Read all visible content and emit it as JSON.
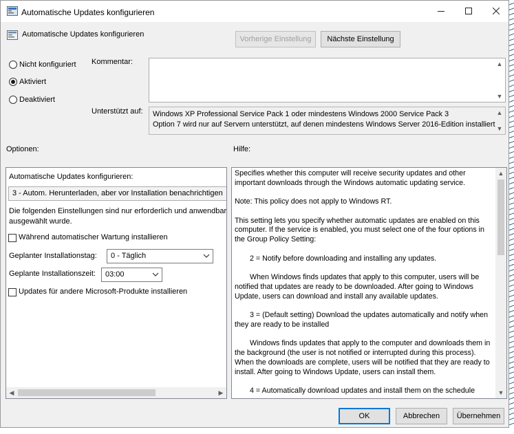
{
  "window": {
    "title": "Automatische Updates konfigurieren",
    "minimize": "—",
    "maximize": "☐",
    "close": "✕"
  },
  "header": {
    "title": "Automatische Updates konfigurieren",
    "prev_button": "Vorherige Einstellung",
    "next_button": "Nächste Einstellung"
  },
  "state": {
    "options": [
      "Nicht konfiguriert",
      "Aktiviert",
      "Deaktiviert"
    ],
    "selected": "Aktiviert"
  },
  "comment": {
    "label": "Kommentar:",
    "value": ""
  },
  "supported": {
    "label": "Unterstützt auf:",
    "line1": "Windows XP Professional Service Pack 1 oder mindestens Windows 2000 Service Pack 3",
    "line2": "Option 7 wird nur auf Servern unterstützt, auf denen mindestens Windows Server 2016-Edition installiert"
  },
  "sections": {
    "options_label": "Optionen:",
    "help_label": "Hilfe:"
  },
  "options_panel": {
    "configure_label": "Automatische Updates konfigurieren:",
    "configure_value": "3 - Autom. Herunterladen, aber vor Installation benachrichtigen",
    "info_line1": "Die folgenden Einstellungen sind nur erforderlich und anwendbar,",
    "info_line2": "ausgewählt wurde.",
    "maintenance_checkbox": "Während automatischer Wartung installieren",
    "day_label": "Geplanter Installationstag:",
    "day_value": "0 - Täglich",
    "time_label": "Geplante Installationszeit:",
    "time_value": "03:00",
    "other_products_checkbox": "Updates für andere Microsoft-Produkte installieren"
  },
  "help": {
    "paragraphs": [
      {
        "indent": false,
        "text": "Specifies whether this computer will receive security updates and other important downloads through the Windows automatic updating service."
      },
      {
        "indent": false,
        "text": "Note: This policy does not apply to Windows RT."
      },
      {
        "indent": false,
        "text": "This setting lets you specify whether automatic updates are enabled on this computer. If the service is enabled, you must select one of the four options in the Group Policy Setting:"
      },
      {
        "indent": true,
        "text": "2 = Notify before downloading and installing any updates."
      },
      {
        "indent": true,
        "text": "When Windows finds updates that apply to this computer, users will be notified that updates are ready to be downloaded. After going to Windows Update, users can download and install any available updates."
      },
      {
        "indent": true,
        "text": "3 = (Default setting) Download the updates automatically and notify when they are ready to be installed"
      },
      {
        "indent": true,
        "text": "Windows finds updates that apply to the computer and downloads them in the background (the user is not notified or interrupted during this process). When the downloads are complete, users will be notified that they are ready to install. After going to Windows Update, users can install them."
      },
      {
        "indent": true,
        "text": "4 = Automatically download updates and install them on the schedule"
      }
    ]
  },
  "footer": {
    "ok": "OK",
    "cancel": "Abbrechen",
    "apply": "Übernehmen"
  }
}
